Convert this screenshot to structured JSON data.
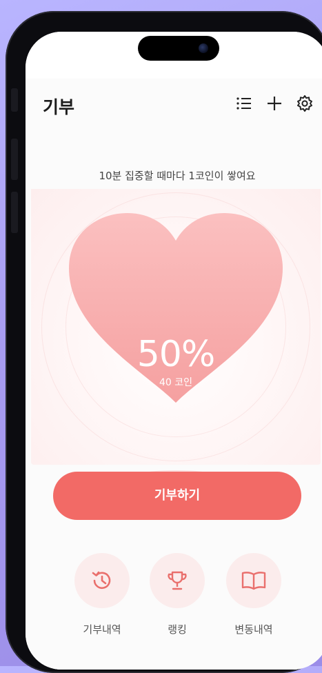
{
  "header": {
    "title": "기부",
    "icons": [
      "list-icon",
      "plus-icon",
      "gear-icon"
    ]
  },
  "subtitle": "10분 집중할 때마다 1코인이 쌓여요",
  "progress": {
    "percent_label": "50%",
    "percent_value": 50,
    "coins_label": "40 코인"
  },
  "donate_button": {
    "label": "기부하기"
  },
  "menu": [
    {
      "label": "기부내역",
      "icon": "history-icon"
    },
    {
      "label": "랭킹",
      "icon": "trophy-icon"
    },
    {
      "label": "변동내역",
      "icon": "book-icon"
    }
  ],
  "colors": {
    "accent": "#f26a66",
    "heart_top": "#fbb8b8",
    "heart_bottom": "#f6a8a8",
    "circle_bg": "#fbecec"
  }
}
